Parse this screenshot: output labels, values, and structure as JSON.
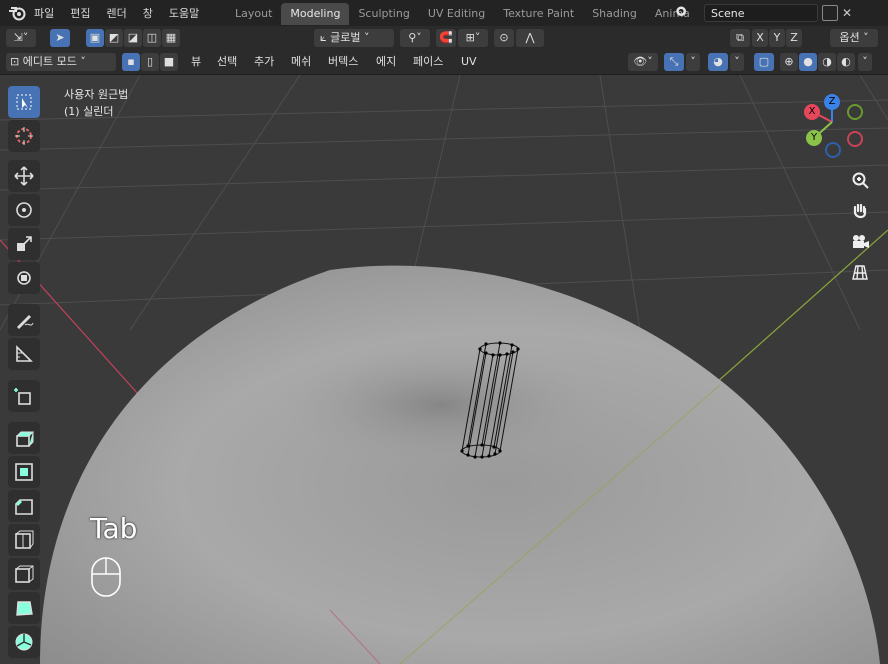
{
  "menubar": {
    "items": [
      "파일",
      "편집",
      "렌더",
      "창",
      "도움말"
    ]
  },
  "workspaces": {
    "tabs": [
      "Layout",
      "Modeling",
      "Sculpting",
      "UV Editing",
      "Texture Paint",
      "Shading",
      "Anima"
    ],
    "active": "Modeling"
  },
  "scene": {
    "name": "Scene"
  },
  "header1": {
    "transform_orientation": "글로벌",
    "axes": [
      "X",
      "Y",
      "Z"
    ],
    "options": "옵션"
  },
  "header2": {
    "mode": "에디트 모드",
    "menus": [
      "뷰",
      "선택",
      "추가",
      "메쉬",
      "버텍스",
      "에지",
      "페이스",
      "UV"
    ]
  },
  "viewport": {
    "view_name": "사용자 원근법",
    "object_name": "(1) 실린더",
    "key_hint": "Tab"
  },
  "gizmo": {
    "x": "X",
    "y": "Y",
    "z": "Z"
  },
  "colors": {
    "accent": "#4772b3",
    "x_axis": "#e6485b",
    "y_axis": "#8bc34a",
    "z_axis": "#3b82e6"
  }
}
